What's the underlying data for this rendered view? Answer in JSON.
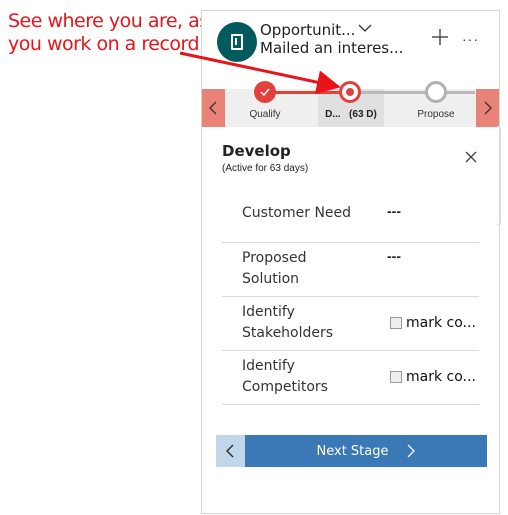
{
  "annotation": {
    "line1": "See where you are, as",
    "line2": "you work on a record.",
    "color": "#e8141a"
  },
  "header": {
    "entity_title": "Opportunit...",
    "record_subtitle": "Mailed an interes...",
    "avatar_icon": "document-icon",
    "expand_icon": "chevron-down-icon",
    "add_icon": "plus-icon",
    "more_label": "···",
    "avatar_color": "#035a5c"
  },
  "stages": {
    "items": [
      {
        "label": "Qualify",
        "state": "completed"
      },
      {
        "label": "D...",
        "suffix": "(63 D)",
        "state": "active"
      },
      {
        "label": "Propose",
        "state": "upcoming"
      }
    ],
    "prev_icon": "chevron-left-icon",
    "next_icon": "chevron-right-icon",
    "accent_color": "#e2413b",
    "nav_color": "#e98378"
  },
  "panel": {
    "title": "Develop",
    "subtitle": "(Active for 63 days)",
    "close_icon": "close-icon",
    "fields": [
      {
        "label_line1": "Customer Need",
        "label_line2": "",
        "value": "---",
        "type": "text"
      },
      {
        "label_line1": "Proposed",
        "label_line2": "Solution",
        "value": "---",
        "type": "text"
      },
      {
        "label_line1": "Identify",
        "label_line2": "Stakeholders",
        "value": "mark co...",
        "type": "checkbox",
        "checked": false
      },
      {
        "label_line1": "Identify",
        "label_line2": "Competitors",
        "value": "mark co...",
        "type": "checkbox",
        "checked": false
      }
    ]
  },
  "footer": {
    "back_icon": "chevron-left-icon",
    "next_stage_label": "Next Stage",
    "next_icon": "chevron-right-icon",
    "primary_color": "#3b79b6"
  }
}
